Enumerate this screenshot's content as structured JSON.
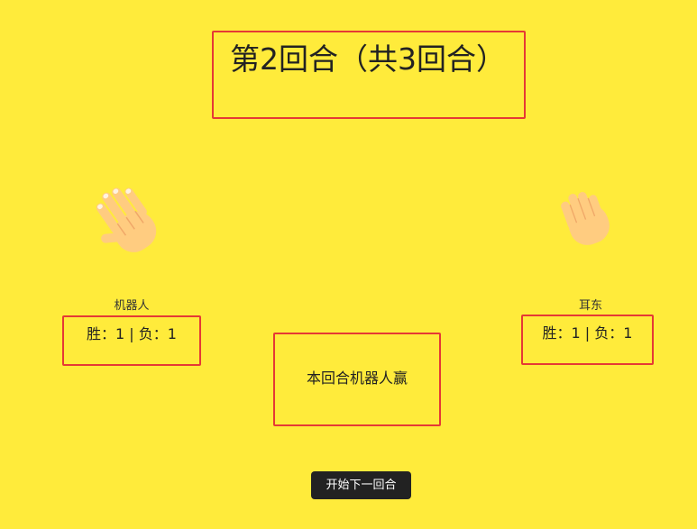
{
  "round": {
    "title": "第2回合（共3回合）"
  },
  "players": {
    "left": {
      "name": "机器人",
      "hand_icon": "waving-open-hand-icon",
      "score": "胜：1 | 负：1"
    },
    "right": {
      "name": "耳东",
      "hand_icon": "raised-back-of-hand-icon",
      "score": "胜：1 | 负：1"
    }
  },
  "result": {
    "text": "本回合机器人赢"
  },
  "controls": {
    "next_round_label": "开始下一回合"
  },
  "colors": {
    "background": "#ffeb3b",
    "box_border": "#e53935",
    "button_bg": "#222222",
    "skin": "#ffcc80"
  }
}
